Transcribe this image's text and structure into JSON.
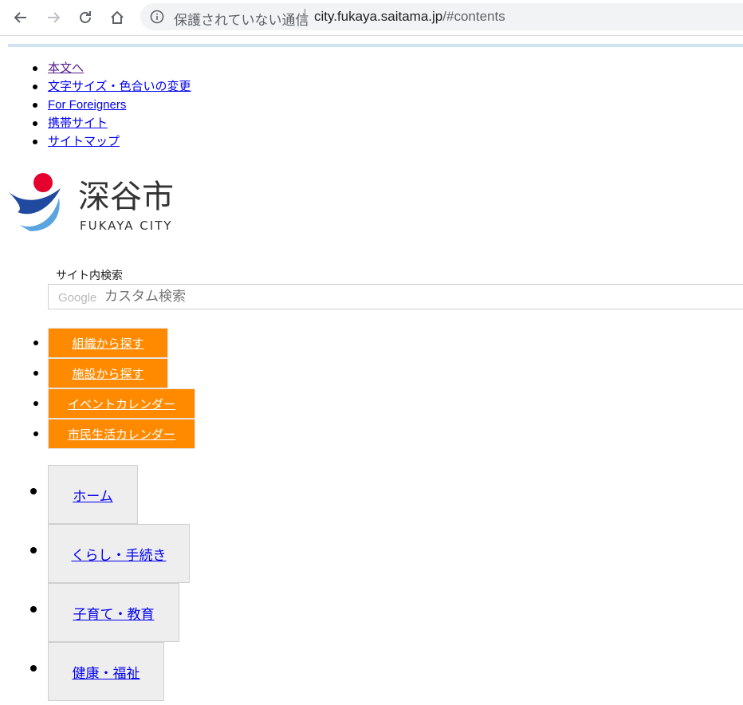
{
  "browser": {
    "security_text": "保護されていない通信",
    "url_host": "city.fukaya.saitama.jp",
    "url_path": "/#contents"
  },
  "skip_links": [
    {
      "label": "本文へ"
    },
    {
      "label": "文字サイズ・色合いの変更"
    },
    {
      "label": "For Foreigners"
    },
    {
      "label": "携帯サイト"
    },
    {
      "label": "サイトマップ"
    }
  ],
  "logo": {
    "name_ja": "深谷市",
    "name_en": "FUKAYA CITY",
    "colors": {
      "red": "#e5002d",
      "blue": "#1f4aa0",
      "light_blue": "#5aa5e0"
    }
  },
  "search": {
    "label": "サイト内検索",
    "google_word": "Google",
    "placeholder": "カスタム検索"
  },
  "quick_buttons": [
    {
      "label": "組織から探す"
    },
    {
      "label": "施設から探す"
    },
    {
      "label": "イベントカレンダー"
    },
    {
      "label": "市民生活カレンダー"
    }
  ],
  "main_nav": [
    {
      "label": "ホーム"
    },
    {
      "label": "くらし・手続き"
    },
    {
      "label": "子育て・教育"
    },
    {
      "label": "健康・福祉"
    }
  ],
  "colors": {
    "accent_orange": "#ff8a00",
    "top_bar": "#cfe3f1",
    "link": "#0000ee",
    "visited_link": "#551a8b"
  }
}
